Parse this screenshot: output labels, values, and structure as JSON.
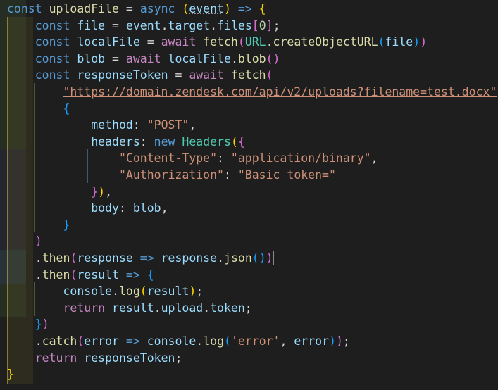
{
  "editor": {
    "theme_colors": {
      "keyword": "#569cd6",
      "control": "#c586c0",
      "variable": "#9cdcfe",
      "function": "#dcdcaa",
      "string": "#ce9178",
      "class": "#4ec9b0",
      "number": "#b5cea8",
      "bracket1": "#ffd700",
      "bracket2": "#da70d6",
      "bracket3": "#179fff",
      "plain": "#d4d4d4"
    },
    "lines": [
      {
        "indent": "",
        "tokens": [
          [
            "kw",
            "const"
          ],
          [
            "p",
            " "
          ],
          [
            "fn",
            "uploadFile"
          ],
          [
            "p",
            " "
          ],
          [
            "op",
            "="
          ],
          [
            "p",
            " "
          ],
          [
            "kw",
            "async"
          ],
          [
            "p",
            " "
          ],
          [
            "b1",
            "("
          ],
          [
            "vr",
            "event"
          ],
          [
            "b1",
            ")"
          ],
          [
            "p",
            " "
          ],
          [
            "kw",
            "=>"
          ],
          [
            "p",
            " "
          ],
          [
            "b1",
            "{"
          ]
        ]
      },
      {
        "indent": "    ",
        "tokens": [
          [
            "kw",
            "const"
          ],
          [
            "p",
            " "
          ],
          [
            "vr",
            "file"
          ],
          [
            "p",
            " "
          ],
          [
            "op",
            "="
          ],
          [
            "p",
            " "
          ],
          [
            "vr",
            "event"
          ],
          [
            "p",
            "."
          ],
          [
            "vr",
            "target"
          ],
          [
            "p",
            "."
          ],
          [
            "vr",
            "files"
          ],
          [
            "b2",
            "["
          ],
          [
            "nm",
            "0"
          ],
          [
            "b2",
            "]"
          ],
          [
            "p",
            ";"
          ]
        ]
      },
      {
        "indent": "    ",
        "tokens": [
          [
            "kw",
            "const"
          ],
          [
            "p",
            " "
          ],
          [
            "vr",
            "localFile"
          ],
          [
            "p",
            " "
          ],
          [
            "op",
            "="
          ],
          [
            "p",
            " "
          ],
          [
            "ct",
            "await"
          ],
          [
            "p",
            " "
          ],
          [
            "fn",
            "fetch"
          ],
          [
            "b2",
            "("
          ],
          [
            "cl",
            "URL"
          ],
          [
            "p",
            "."
          ],
          [
            "fn",
            "createObjectURL"
          ],
          [
            "b3",
            "("
          ],
          [
            "vr",
            "file"
          ],
          [
            "b3",
            ")"
          ],
          [
            "b2",
            ")"
          ]
        ]
      },
      {
        "indent": "    ",
        "tokens": [
          [
            "kw",
            "const"
          ],
          [
            "p",
            " "
          ],
          [
            "vr",
            "blob"
          ],
          [
            "p",
            " "
          ],
          [
            "op",
            "="
          ],
          [
            "p",
            " "
          ],
          [
            "ct",
            "await"
          ],
          [
            "p",
            " "
          ],
          [
            "vr",
            "localFile"
          ],
          [
            "p",
            "."
          ],
          [
            "fn",
            "blob"
          ],
          [
            "b2",
            "()"
          ]
        ]
      },
      {
        "indent": "    ",
        "tokens": [
          [
            "kw",
            "const"
          ],
          [
            "p",
            " "
          ],
          [
            "vr",
            "responseToken"
          ],
          [
            "p",
            " "
          ],
          [
            "op",
            "="
          ],
          [
            "p",
            " "
          ],
          [
            "ct",
            "await"
          ],
          [
            "p",
            " "
          ],
          [
            "fn",
            "fetch"
          ],
          [
            "b2",
            "("
          ]
        ]
      },
      {
        "indent": "        ",
        "tokens": [
          [
            "st",
            "\"https://domain.zendesk.com/api/v2/uploads?filename=test.docx\""
          ],
          [
            "p",
            ","
          ]
        ]
      },
      {
        "indent": "        ",
        "tokens": [
          [
            "b3",
            "{"
          ]
        ]
      },
      {
        "indent": "            ",
        "tokens": [
          [
            "vr",
            "method"
          ],
          [
            "p",
            ": "
          ],
          [
            "st",
            "\"POST\""
          ],
          [
            "p",
            ","
          ]
        ]
      },
      {
        "indent": "            ",
        "tokens": [
          [
            "vr",
            "headers"
          ],
          [
            "p",
            ": "
          ],
          [
            "kw",
            "new"
          ],
          [
            "p",
            " "
          ],
          [
            "cl",
            "Headers"
          ],
          [
            "b1",
            "("
          ],
          [
            "b2",
            "{"
          ]
        ]
      },
      {
        "indent": "                ",
        "tokens": [
          [
            "st",
            "\"Content-Type\""
          ],
          [
            "p",
            ": "
          ],
          [
            "st",
            "\"application/binary\""
          ],
          [
            "p",
            ","
          ]
        ]
      },
      {
        "indent": "                ",
        "tokens": [
          [
            "st",
            "\"Authorization\""
          ],
          [
            "p",
            ": "
          ],
          [
            "st",
            "\"Basic token=\""
          ]
        ]
      },
      {
        "indent": "            ",
        "tokens": [
          [
            "b2",
            "}"
          ],
          [
            "b1",
            ")"
          ],
          [
            "p",
            ","
          ]
        ]
      },
      {
        "indent": "            ",
        "tokens": [
          [
            "vr",
            "body"
          ],
          [
            "p",
            ": "
          ],
          [
            "vr",
            "blob"
          ],
          [
            "p",
            ","
          ]
        ]
      },
      {
        "indent": "        ",
        "tokens": [
          [
            "b3",
            "}"
          ]
        ]
      },
      {
        "indent": "    ",
        "tokens": [
          [
            "b2",
            ")"
          ]
        ]
      },
      {
        "indent": "    ",
        "tokens": [
          [
            "p",
            "."
          ],
          [
            "fn",
            "then"
          ],
          [
            "b2",
            "("
          ],
          [
            "vr",
            "response"
          ],
          [
            "p",
            " "
          ],
          [
            "kw",
            "=>"
          ],
          [
            "p",
            " "
          ],
          [
            "vr",
            "response"
          ],
          [
            "p",
            "."
          ],
          [
            "fn",
            "json"
          ],
          [
            "b3",
            "()"
          ],
          [
            "b2m",
            ")"
          ]
        ]
      },
      {
        "indent": "    ",
        "tokens": [
          [
            "p",
            "."
          ],
          [
            "fn",
            "then"
          ],
          [
            "b2",
            "("
          ],
          [
            "vr",
            "result"
          ],
          [
            "p",
            " "
          ],
          [
            "kw",
            "=>"
          ],
          [
            "p",
            " "
          ],
          [
            "b3",
            "{"
          ]
        ]
      },
      {
        "indent": "        ",
        "tokens": [
          [
            "vr",
            "console"
          ],
          [
            "p",
            "."
          ],
          [
            "fn",
            "log"
          ],
          [
            "b1",
            "("
          ],
          [
            "vr",
            "result"
          ],
          [
            "b1",
            ")"
          ],
          [
            "p",
            ";"
          ]
        ]
      },
      {
        "indent": "        ",
        "tokens": [
          [
            "ct",
            "return"
          ],
          [
            "p",
            " "
          ],
          [
            "vr",
            "result"
          ],
          [
            "p",
            "."
          ],
          [
            "vr",
            "upload"
          ],
          [
            "p",
            "."
          ],
          [
            "vr",
            "token"
          ],
          [
            "p",
            ";"
          ]
        ]
      },
      {
        "indent": "    ",
        "tokens": [
          [
            "b3",
            "}"
          ],
          [
            "b2",
            ")"
          ]
        ]
      },
      {
        "indent": "    ",
        "tokens": [
          [
            "p",
            "."
          ],
          [
            "fn",
            "catch"
          ],
          [
            "b2",
            "("
          ],
          [
            "vr",
            "error"
          ],
          [
            "p",
            " "
          ],
          [
            "kw",
            "=>"
          ],
          [
            "p",
            " "
          ],
          [
            "vr",
            "console"
          ],
          [
            "p",
            "."
          ],
          [
            "fn",
            "log"
          ],
          [
            "b3",
            "("
          ],
          [
            "st",
            "'error'"
          ],
          [
            "p",
            ", "
          ],
          [
            "vr",
            "error"
          ],
          [
            "b3",
            ")"
          ],
          [
            "b2",
            ")"
          ],
          [
            "p",
            ";"
          ]
        ]
      },
      {
        "indent": "    ",
        "tokens": [
          [
            "ct",
            "return"
          ],
          [
            "p",
            " "
          ],
          [
            "vr",
            "responseToken"
          ],
          [
            "p",
            ";"
          ]
        ]
      },
      {
        "indent": "",
        "tokens": [
          [
            "b1",
            "}"
          ]
        ]
      }
    ]
  }
}
